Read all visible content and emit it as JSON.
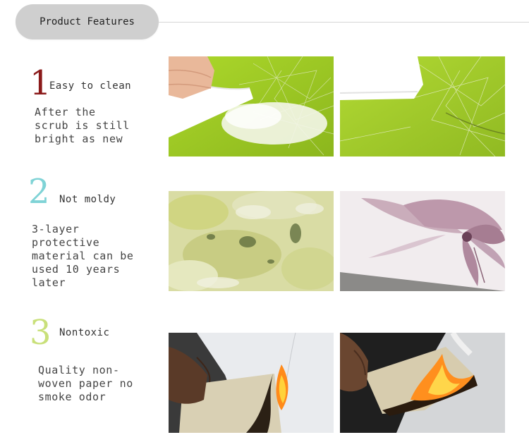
{
  "header": {
    "title": "Product Features"
  },
  "features": [
    {
      "number": "1",
      "number_color": "#8b1a1a",
      "title": "Easy to clean",
      "description": "After the\nscrub is still\nbright as new"
    },
    {
      "number": "2",
      "number_color": "#7fd3d6",
      "title": "Not moldy",
      "description": "3-layer\nprotective\nmaterial can be\nused 10 years\nlater"
    },
    {
      "number": "3",
      "number_color": "#c9e07a",
      "title": "Nontoxic",
      "description": "Quality non-\nwoven paper no\nsmoke odor"
    }
  ],
  "photos": [
    {
      "name": "cloth-scrubbing-green-wallpaper"
    },
    {
      "name": "cleaned-green-wallpaper"
    },
    {
      "name": "moldy-wallpaper"
    },
    {
      "name": "clean-flower-wallpaper"
    },
    {
      "name": "burning-wallpaper-sample"
    },
    {
      "name": "burning-wallpaper-closeup"
    }
  ]
}
